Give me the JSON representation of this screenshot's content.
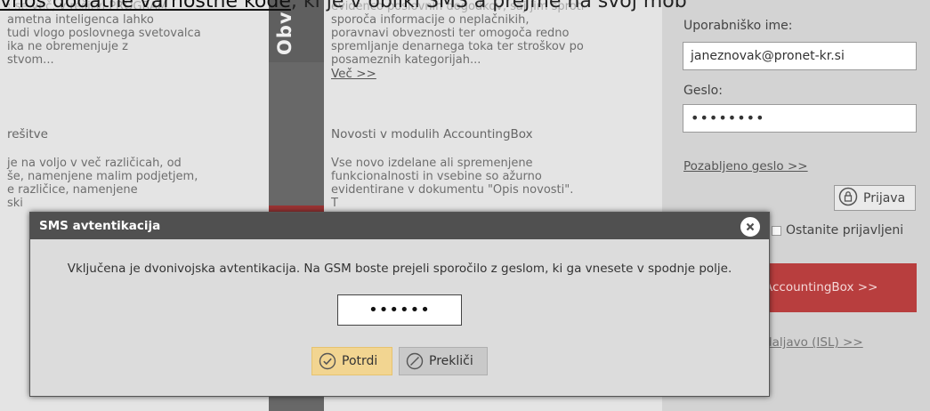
{
  "top_banner": {
    "underlined": "vnos dodatne varnostne kode",
    "rest": ", ki je v obliki SMS a prejme na svoj mob"
  },
  "col1": {
    "para1": [
      ": se več, v rešitvi PROGRAM",
      "ametna inteligenca lahko",
      "tudi vlogo poslovnega svetovalca",
      "ika ne obremenjuje z",
      "stvom..."
    ],
    "heading": "rešitve",
    "para2": [
      "je na voljo v več različicah, od",
      "še, namenjene malim podjetjem,",
      "e različice, namenjene",
      "ski"
    ]
  },
  "vertical_tab": {
    "label": "Obv"
  },
  "col3": {
    "para1": [
      "evidenco poslovnih dogodkov, saj jim sproti",
      "sporoča informacije o neplačnikih,",
      "poravnavi obveznosti ter omogoča redno",
      "spremljanje denarnega toka ter stroškov po",
      "posameznih kategorijah..."
    ],
    "more_link": "Več >>",
    "heading": "Novosti v modulih AccountingBox",
    "para2": [
      "Vse novo izdelane ali spremenjene",
      "funkcionalnosti in vsebine so ažurno",
      "evidentirane v dokumentu \"Opis novosti\".",
      "T"
    ]
  },
  "login": {
    "username_label": "Uporabniško ime:",
    "username_value": "janeznovak@pronet-kr.si",
    "password_label": "Geslo:",
    "password_value": "••••••••",
    "forgot_link": "Pozabljeno geslo >>",
    "login_button": "Prijava",
    "stay_logged_in": "Ostanite prijavljeni",
    "red_button": "AccountingBox >>",
    "remote_link": "daljavo (ISL) >>"
  },
  "dialog": {
    "title": "SMS avtentikacija",
    "close_symbol": "×",
    "message": "Vključena je dvonivojska avtentikacija. Na GSM boste prejeli sporočilo z geslom, ki ga vnesete v spodnje polje.",
    "code_value": "••••••",
    "confirm_label": "Potrdi",
    "cancel_label": "Prekliči"
  },
  "colors": {
    "dialog_header": "#505050",
    "confirm_bg": "#f2d591",
    "red_button": "#b83e3e"
  }
}
